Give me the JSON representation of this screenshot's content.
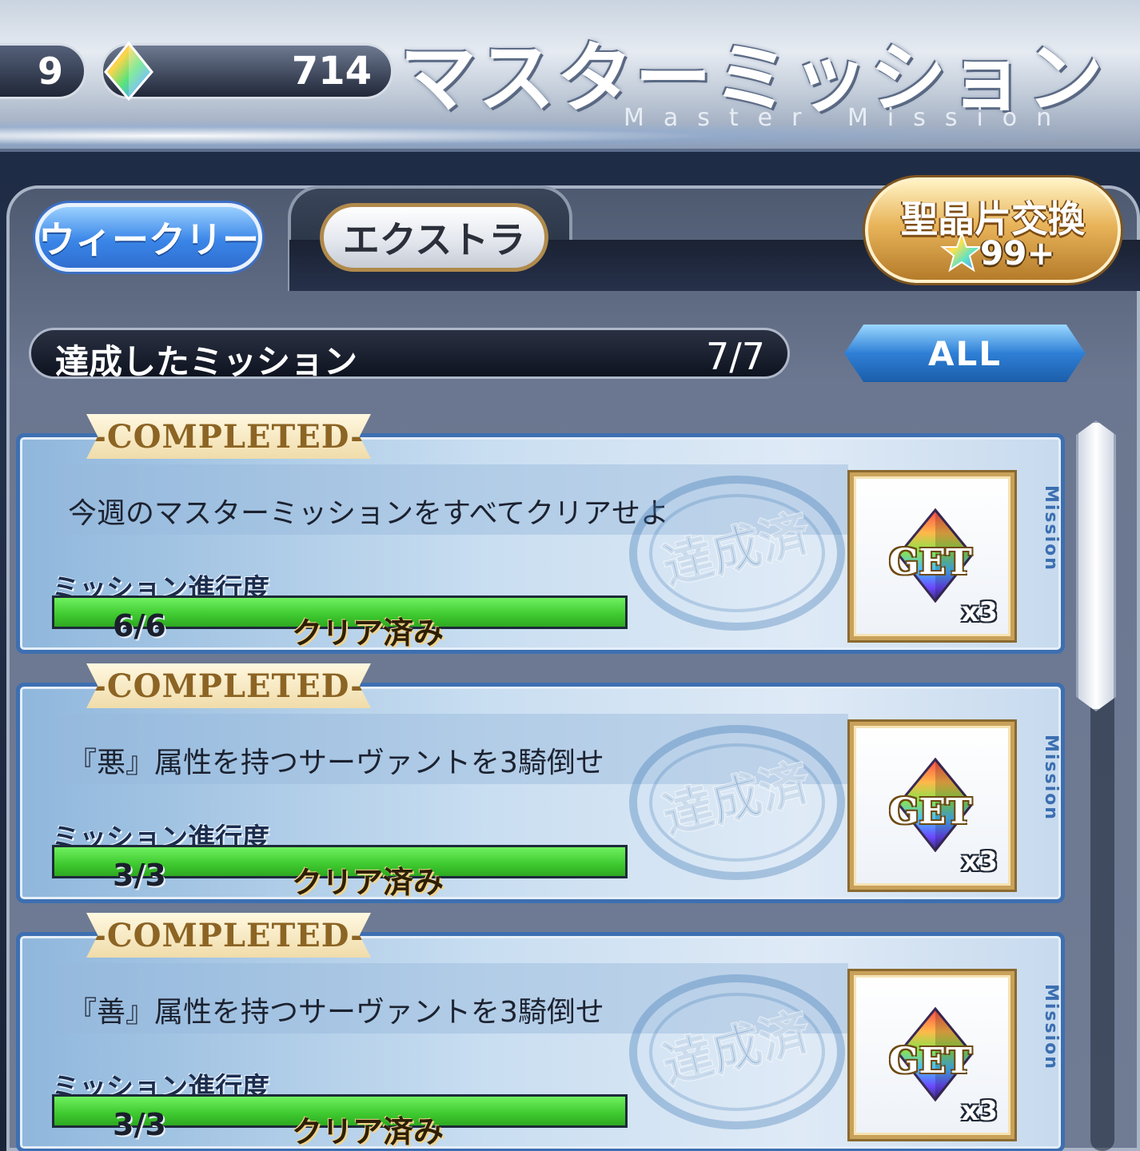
{
  "header": {
    "ap_value": "9",
    "saint_quartz": "714",
    "title_jp": "マスターミッション",
    "title_en": "Master Mission"
  },
  "tabs": [
    {
      "label": "ウィークリー",
      "active": true
    },
    {
      "label": "エクストラ",
      "active": false
    }
  ],
  "exchange": {
    "label": "聖晶片交換",
    "count": "99+"
  },
  "summary": {
    "label": "達成したミッション",
    "count": "7/7",
    "filter": "ALL"
  },
  "missions": [
    {
      "tag": "-COMPLETED-",
      "description": "今週のマスターミッションをすべてクリアせよ",
      "progress_label": "ミッション進行度",
      "progress": "6/6",
      "progress_fraction": 1.0,
      "status": "クリア済み",
      "stamp": "達成済",
      "reward_label": "GET",
      "reward_qty": "x3",
      "side_label": "Mission"
    },
    {
      "tag": "-COMPLETED-",
      "description": "『悪』属性を持つサーヴァントを3騎倒せ",
      "progress_label": "ミッション進行度",
      "progress": "3/3",
      "progress_fraction": 1.0,
      "status": "クリア済み",
      "stamp": "達成済",
      "reward_label": "GET",
      "reward_qty": "x3",
      "side_label": "Mission"
    },
    {
      "tag": "-COMPLETED-",
      "description": "『善』属性を持つサーヴァントを3騎倒せ",
      "progress_label": "ミッション進行度",
      "progress": "3/3",
      "progress_fraction": 1.0,
      "status": "クリア済み",
      "stamp": "達成済",
      "reward_label": "GET",
      "reward_qty": "x3",
      "side_label": "Mission"
    }
  ],
  "icons": {
    "saint_quartz": "rainbow-gem-icon",
    "saint_quartz_fragment": "rainbow-star-icon",
    "reward": "rainbow-gem-icon"
  },
  "colors": {
    "accent_blue": "#3a86e8",
    "progress_green": "#3ec92f",
    "gold": "#c9a15a"
  }
}
